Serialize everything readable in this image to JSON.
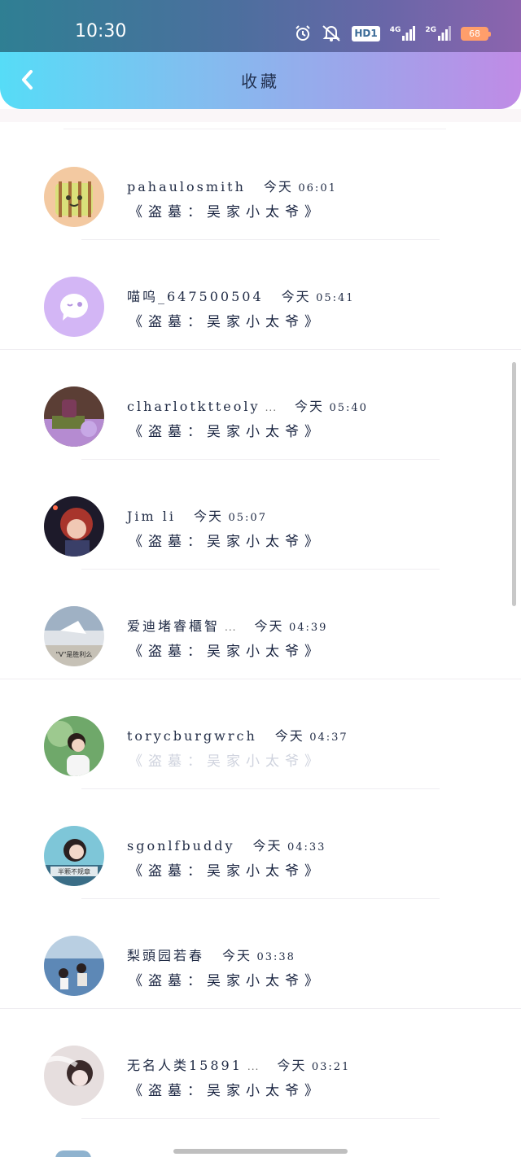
{
  "status_bar": {
    "time": "10:30",
    "hd_label": "HD1",
    "net_4g": "4G",
    "net_2g": "2G",
    "battery": "68"
  },
  "header": {
    "title": "收藏",
    "back_icon": "chevron-left-icon"
  },
  "colors": {
    "header_gradient_start": "#56dcf7",
    "header_gradient_end": "#c08be6",
    "text": "#1f2a44",
    "faded_text": "#cfd3de",
    "battery": "#ff9e6b"
  },
  "items": [
    {
      "name": "pahaulosmith",
      "day": "今天",
      "time": "06:01",
      "book": "《盗墓：吴家小太爷》"
    },
    {
      "name": "喵呜_647500504",
      "day": "今天",
      "time": "05:41",
      "book": "《盗墓：吴家小太爷》"
    },
    {
      "name": "clharlotktteoly",
      "ellipsis": "...",
      "day": "今天",
      "time": "05:40",
      "book": "《盗墓：吴家小太爷》"
    },
    {
      "name": "Jim li",
      "day": "今天",
      "time": "05:07",
      "book": "《盗墓：吴家小太爷》"
    },
    {
      "name": "爱迪堵睿櫃智",
      "ellipsis": "...",
      "day": "今天",
      "time": "04:39",
      "book": "《盗墓：吴家小太爷》",
      "avatar_text": "\"V\"是胜利么"
    },
    {
      "name": "torycburgwrch",
      "day": "今天",
      "time": "04:37",
      "book": "《盗墓：吴家小太爷》"
    },
    {
      "name": "sgonlfbuddy",
      "day": "今天",
      "time": "04:33",
      "book": "《盗墓：吴家小太爷》",
      "avatar_text": "半颗不规章"
    },
    {
      "name": "梨頭园若春",
      "day": "今天",
      "time": "03:38",
      "book": "《盗墓：吴家小太爷》"
    },
    {
      "name": "无名人类15891",
      "ellipsis": "...",
      "day": "今天",
      "time": "03:21",
      "book": "《盗墓：吴家小太爷》"
    }
  ]
}
